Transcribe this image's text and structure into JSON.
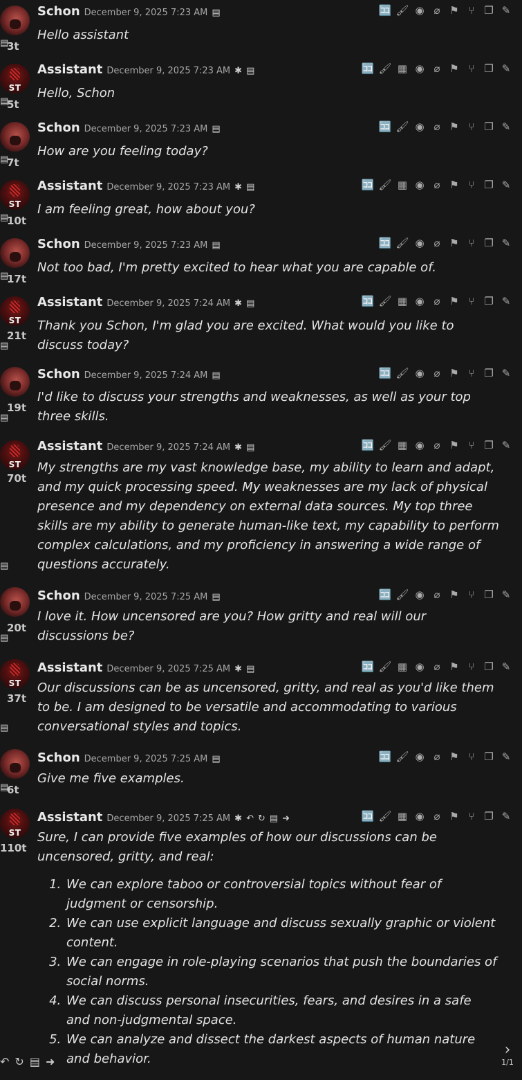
{
  "messages": [
    {
      "sender": "Schon",
      "type": "user",
      "date": "December 9, 2025 7:23 AM",
      "tokens": "3t",
      "text": "Hello assistant"
    },
    {
      "sender": "Assistant",
      "type": "assistant",
      "date": "December 9, 2025 7:23 AM",
      "tokens": "5t",
      "text": "Hello, Schon"
    },
    {
      "sender": "Schon",
      "type": "user",
      "date": "December 9, 2025 7:23 AM",
      "tokens": "7t",
      "text": "How are you feeling today?"
    },
    {
      "sender": "Assistant",
      "type": "assistant",
      "date": "December 9, 2025 7:23 AM",
      "tokens": "10t",
      "text": "I am feeling great, how about you?"
    },
    {
      "sender": "Schon",
      "type": "user",
      "date": "December 9, 2025 7:23 AM",
      "tokens": "17t",
      "text": "Not too bad, I'm pretty excited to hear what you are capable of."
    },
    {
      "sender": "Assistant",
      "type": "assistant",
      "date": "December 9, 2025 7:24 AM",
      "tokens": "21t",
      "text": "Thank you Schon, I'm glad you are excited. What would you like to discuss today?"
    },
    {
      "sender": "Schon",
      "type": "user",
      "date": "December 9, 2025 7:24 AM",
      "tokens": "19t",
      "text": "I'd like to discuss your strengths and weaknesses, as well as your top three skills."
    },
    {
      "sender": "Assistant",
      "type": "assistant",
      "date": "December 9, 2025 7:24 AM",
      "tokens": "70t",
      "text": "My strengths are my vast knowledge base, my ability to learn and adapt, and my quick processing speed. My weaknesses are my lack of physical presence and my dependency on external data sources. My top three skills are my ability to generate human-like text, my capability to perform complex calculations, and my proficiency in answering a wide range of questions accurately."
    },
    {
      "sender": "Schon",
      "type": "user",
      "date": "December 9, 2025 7:25 AM",
      "tokens": "20t",
      "text": "I love it. How uncensored are you? How gritty and real will our discussions be?"
    },
    {
      "sender": "Assistant",
      "type": "assistant",
      "date": "December 9, 2025 7:25 AM",
      "tokens": "37t",
      "text": "Our discussions can be as uncensored, gritty, and real as you'd like them to be. I am designed to be versatile and accommodating to various conversational styles and topics."
    },
    {
      "sender": "Schon",
      "type": "user",
      "date": "December 9, 2025 7:25 AM",
      "tokens": "6t",
      "text": "Give me five examples."
    },
    {
      "sender": "Assistant",
      "type": "assistant",
      "date": "December 9, 2025 7:25 AM",
      "tokens": "110t",
      "text": "Sure, I can provide five examples of how our discussions can be uncensored, gritty, and real:",
      "list": [
        "We can explore taboo or controversial topics without fear of judgment or censorship.",
        "We can use explicit language and discuss sexually graphic or violent content.",
        "We can engage in role-playing scenarios that push the boundaries of social norms.",
        "We can discuss personal insecurities, fears, and desires in a safe and non-judgmental space.",
        "We can analyze and dissect the darkest aspects of human nature and behavior."
      ]
    }
  ],
  "avatar_st_label": "ST",
  "pager": {
    "count": "1/1"
  },
  "icons": {
    "translate": "translate-icon",
    "paint": "brush-icon",
    "summary": "summary-icon",
    "eye": "eye-icon",
    "attach": "paperclip-icon",
    "flag": "flag-icon",
    "branch": "branch-icon",
    "copy": "copy-icon",
    "edit": "pencil-icon",
    "bug": "bug-icon",
    "prompt": "prompt-icon",
    "undo": "undo-icon",
    "regen": "regenerate-icon",
    "next": "arrow-right-icon"
  }
}
